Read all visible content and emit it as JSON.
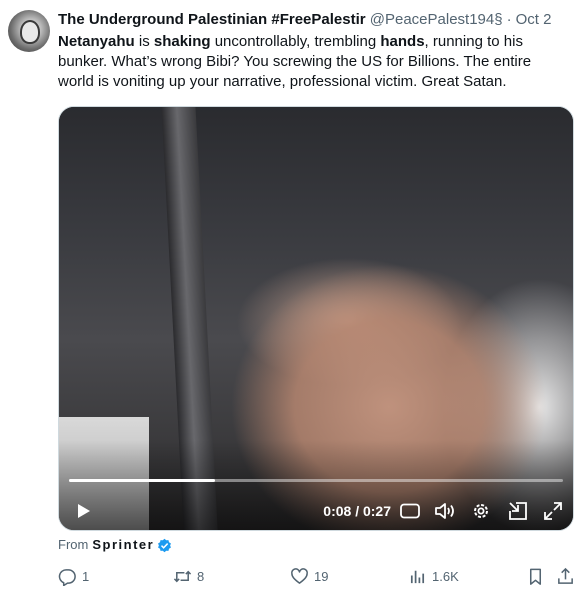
{
  "author": {
    "name": "The Underground Palestinian #FreePalestir",
    "handle": "@PeacePalest194§",
    "separator": "·",
    "date": "Oct 2"
  },
  "tweet": {
    "parts": [
      {
        "text": "Netanyahu",
        "bold": true
      },
      {
        "text": " is ",
        "bold": false
      },
      {
        "text": "shaking",
        "bold": true
      },
      {
        "text": " uncontrollably, trembling ",
        "bold": false
      },
      {
        "text": "hands",
        "bold": true
      },
      {
        "text": ", running to his bunker. What’s wrong Bibi? You screwing the US for Billions. The entire world is voniting up your narrative, professional victim. Great Satan.",
        "bold": false
      }
    ]
  },
  "video": {
    "time_label": "0:08 / 0:27",
    "progress": 0.296,
    "cc_label": "CC"
  },
  "source": {
    "prefix": "From",
    "app": "Sprinter"
  },
  "actions": {
    "replies": "1",
    "reposts": "8",
    "likes": "19",
    "views": "1.6K"
  },
  "colors": {
    "muted": "#536471",
    "text": "#0f1419",
    "verified": "#1d9bf0"
  }
}
